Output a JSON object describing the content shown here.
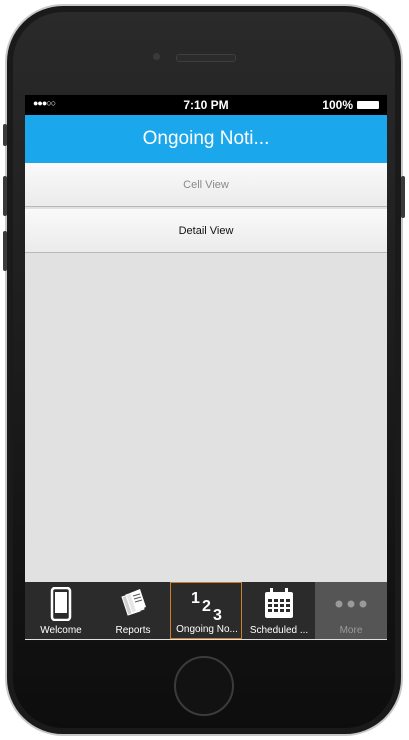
{
  "status_bar": {
    "signal": "●●●○○",
    "time": "7:10 PM",
    "battery": "100%"
  },
  "nav": {
    "title": "Ongoing Noti..."
  },
  "list": [
    {
      "label": "Cell View"
    },
    {
      "label": "Detail View"
    }
  ],
  "tabs": [
    {
      "label": "Welcome",
      "icon": "phone-icon"
    },
    {
      "label": "Reports",
      "icon": "reports-icon"
    },
    {
      "label": "Ongoing No...",
      "icon": "numbers-123-icon",
      "selected": true
    },
    {
      "label": "Scheduled ...",
      "icon": "calendar-icon"
    },
    {
      "label": "More",
      "icon": "more-dots-icon"
    }
  ],
  "colors": {
    "nav_bar": "#1ba7eb",
    "tab_bar": "#2b2b2b",
    "selected_tab_border": "#c9822b",
    "screen_bg": "#e1e1e1"
  }
}
